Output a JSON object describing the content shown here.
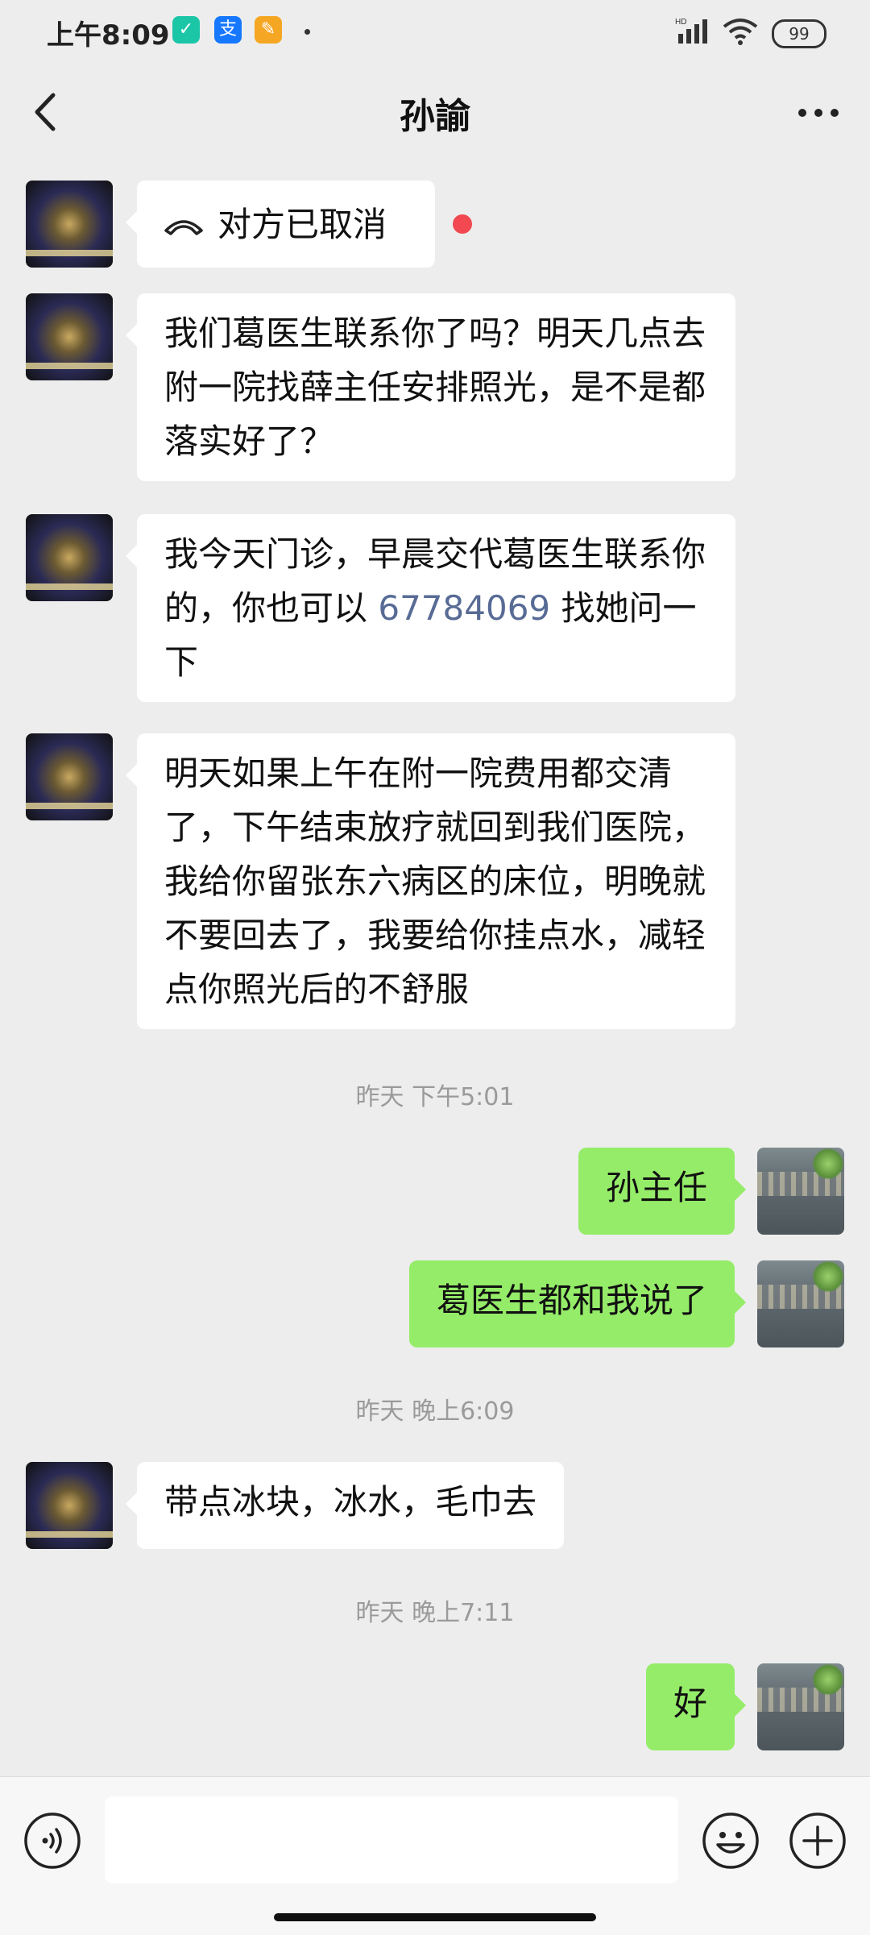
{
  "status_bar": {
    "time": "上午8:09",
    "battery": "99"
  },
  "header": {
    "title": "孙諭"
  },
  "messages": {
    "call_text": "对方已取消",
    "m1": "我们葛医生联系你了吗？明天几点去附一院找薛主任安排照光，是不是都落实好了？",
    "m2_before": "我今天门诊，早晨交代葛医生联系你的，你也可以 ",
    "m2_phone": "67784069",
    "m2_after": " 找她问一下",
    "m3": "明天如果上午在附一院费用都交清了，下午结束放疗就回到我们医院，我给你留张东六病区的床位，明晚就不要回去了，我要给你挂点水，减轻点你照光后的不舒服",
    "ts1": "昨天 下午5:01",
    "m4": "孙主任",
    "m5": "葛医生都和我说了",
    "ts2": "昨天 晚上6:09",
    "m6": "带点冰块，冰水，毛巾去",
    "ts3": "昨天 晚上7:11",
    "m7": "好"
  },
  "input": {
    "value": ""
  },
  "colors": {
    "background": "#EDEDED",
    "outgoing_bubble": "#95EC69",
    "incoming_bubble": "#FFFFFF",
    "link": "#576B95",
    "unread_dot": "#F2484F"
  },
  "icons": [
    "shield-icon",
    "alipay-icon",
    "app-icon",
    "signal-icon",
    "wifi-icon",
    "battery-icon",
    "back-icon",
    "more-icon",
    "call-declined-icon",
    "voice-icon",
    "emoji-icon",
    "plus-icon"
  ]
}
